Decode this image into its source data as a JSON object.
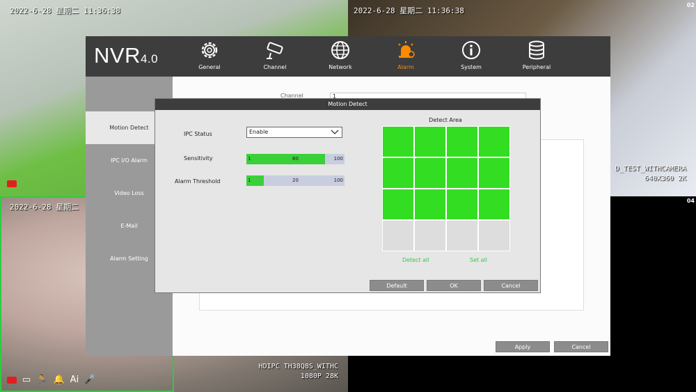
{
  "feeds": {
    "feed1": {
      "timestamp": "2022-6-28 星期二 11:36:38"
    },
    "feed2": {
      "timestamp": "2022-6-28 星期二 11:36:38",
      "channel": "02",
      "label_line1": "D_TEST_WITHCAMERA",
      "label_line2": "640X360 2K"
    },
    "feed3": {
      "timestamp": "2022-6-28 星期二",
      "label_line1": "HDIPC TH38Q8S_WITHC",
      "label_line2": "1080P 28K"
    },
    "feed4": {
      "channel": "04"
    }
  },
  "logo": {
    "main": "NVR",
    "version": "4.0"
  },
  "nav": [
    {
      "label": "General",
      "icon": "gear-icon"
    },
    {
      "label": "Channel",
      "icon": "camera-icon"
    },
    {
      "label": "Network",
      "icon": "globe-icon"
    },
    {
      "label": "Alarm",
      "icon": "alarm-icon",
      "active": true
    },
    {
      "label": "System",
      "icon": "info-icon"
    },
    {
      "label": "Peripheral",
      "icon": "database-icon"
    }
  ],
  "sidebar": [
    {
      "label": "Motion Detect",
      "active": true
    },
    {
      "label": "IPC I/O Alarm"
    },
    {
      "label": "Video Loss"
    },
    {
      "label": "E-Mail"
    },
    {
      "label": "Alarm Setting"
    }
  ],
  "main": {
    "channel_label": "Channel",
    "channel_value": "1",
    "apply_label": "Apply",
    "cancel_label": "Cancel"
  },
  "dialog": {
    "title": "Motion Detect",
    "ipc_status_label": "IPC Status",
    "ipc_status_value": "Enable",
    "sensitivity_label": "Sensitivity",
    "sensitivity": {
      "min": "1",
      "value": "80",
      "max": "100",
      "fraction": 0.8
    },
    "threshold_label": "Alarm Threshold",
    "threshold": {
      "min": "1",
      "value": "20",
      "max": "100",
      "fraction": 0.18
    },
    "detect_area_label": "Detect Area",
    "grid": [
      [
        true,
        true,
        true,
        true
      ],
      [
        true,
        true,
        true,
        true
      ],
      [
        true,
        true,
        true,
        true
      ],
      [
        false,
        false,
        false,
        false
      ]
    ],
    "detect_all_label": "Detect all",
    "set_all_label": "Set all",
    "default_label": "Default",
    "ok_label": "OK",
    "cancel_label": "Cancel"
  },
  "status_icons": [
    "record-icon",
    "monitor-icon",
    "motion-icon",
    "bell-icon",
    "ai-icon",
    "mic-icon"
  ],
  "status_ai_text": "Ai",
  "colors": {
    "accent": "#ff8a00",
    "grid_on": "#33dd22",
    "slider_fill": "#3ad03a",
    "link": "#2ecc40"
  }
}
